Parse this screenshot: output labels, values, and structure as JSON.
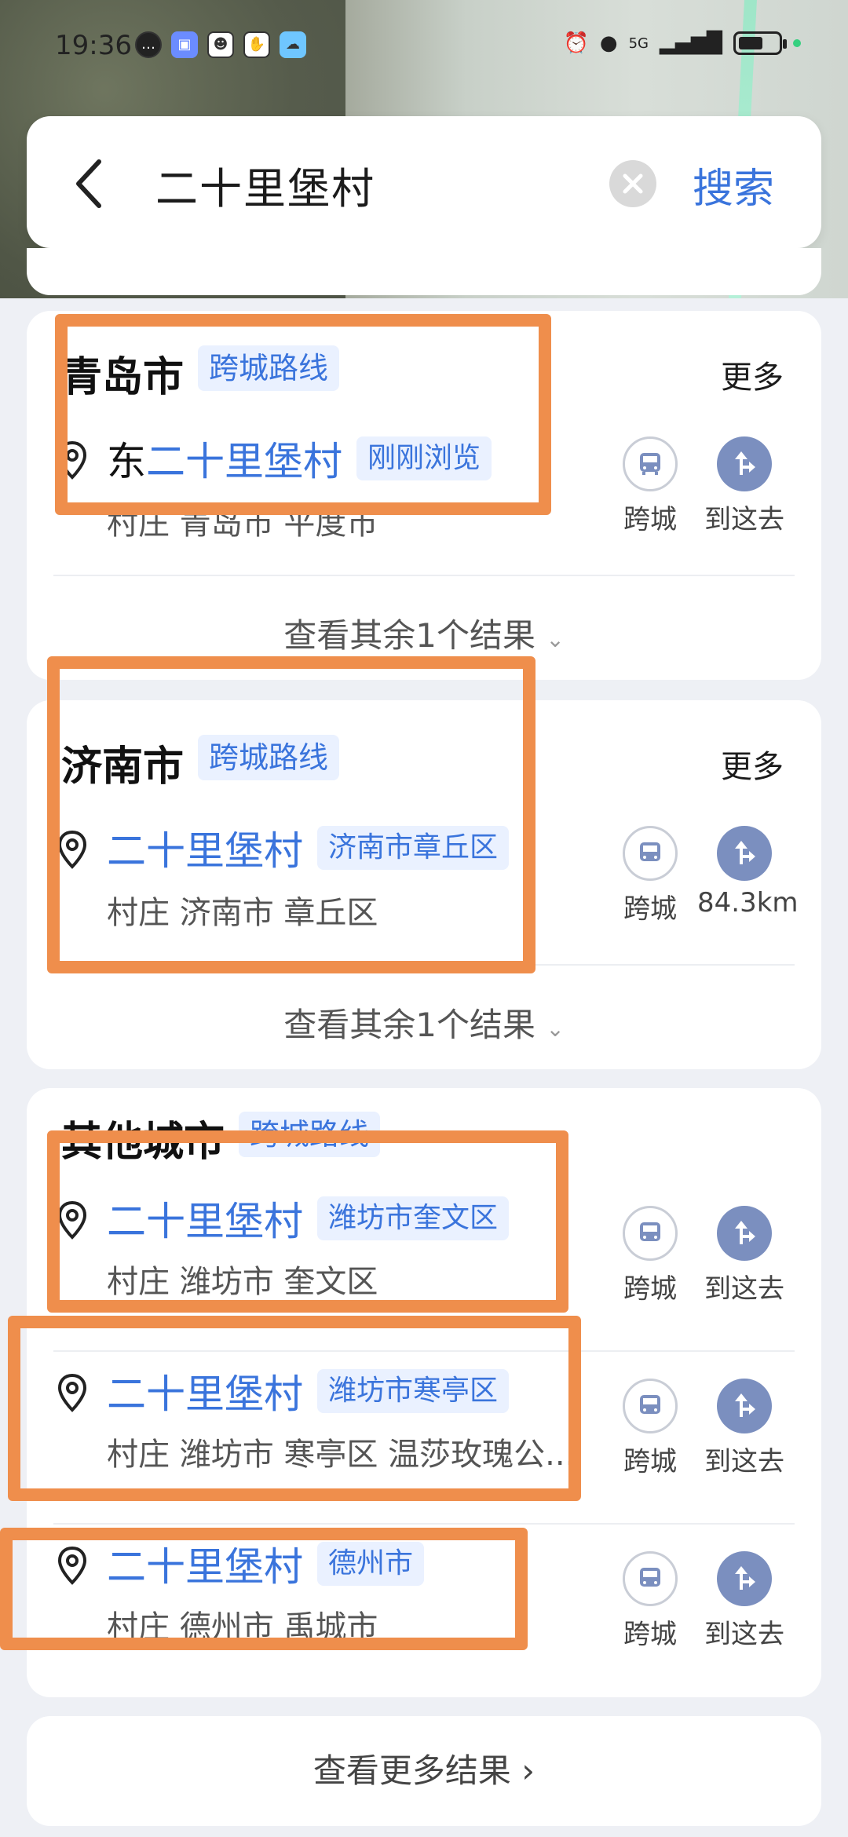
{
  "status_bar": {
    "time": "19:36",
    "left_icons": [
      "message-icon",
      "store-icon",
      "app-icon",
      "hand-icon",
      "weather-icon"
    ],
    "network": "5G"
  },
  "search": {
    "query": "二十里堡村",
    "search_label": "搜索"
  },
  "groups": [
    {
      "city": "青岛市",
      "route_tag": "跨城路线",
      "more": "更多",
      "result": {
        "title_prefix": "东",
        "title": "二十里堡村",
        "tag": "刚刚浏览",
        "subtitle": "村庄 青岛市 平度市",
        "action1": "跨城",
        "action2": "到这去"
      },
      "expand": "查看其余1个结果"
    },
    {
      "city": "济南市",
      "route_tag": "跨城路线",
      "more": "更多",
      "result": {
        "title": "二十里堡村",
        "tag": "济南市章丘区",
        "subtitle": "村庄 济南市 章丘区",
        "action1": "跨城",
        "action2": "84.3km"
      },
      "expand": "查看其余1个结果"
    },
    {
      "city": "其他城市",
      "route_tag": "跨城路线",
      "results": [
        {
          "title": "二十里堡村",
          "tag": "潍坊市奎文区",
          "subtitle": "村庄 潍坊市 奎文区",
          "action1": "跨城",
          "action2": "到这去"
        },
        {
          "title": "二十里堡村",
          "tag": "潍坊市寒亭区",
          "subtitle": "村庄 潍坊市 寒亭区 温莎玫瑰公...",
          "action1": "跨城",
          "action2": "到这去"
        },
        {
          "title": "二十里堡村",
          "tag": "德州市",
          "subtitle": "村庄 德州市 禹城市",
          "action1": "跨城",
          "action2": "到这去"
        }
      ]
    }
  ],
  "more_results": "查看更多结果 ›",
  "colors": {
    "accent": "#3a74dc",
    "tag_bg": "#eaf1ff",
    "highlight": "#ef8e4c",
    "go_button": "#7b8fbf"
  }
}
